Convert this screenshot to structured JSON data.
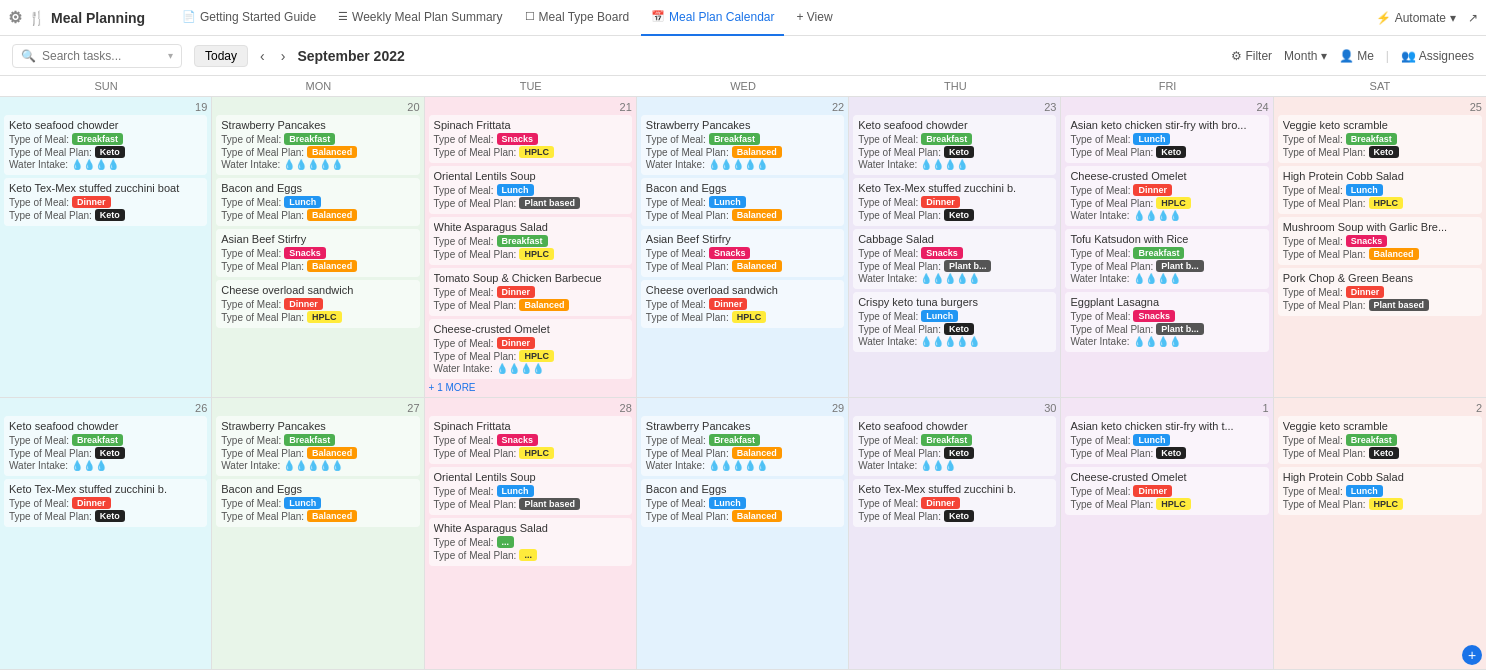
{
  "app": {
    "title": "Meal Planning",
    "logo_icon": "🍴"
  },
  "nav_tabs": [
    {
      "label": "Getting Started Guide",
      "icon": "📄",
      "active": false
    },
    {
      "label": "Weekly Meal Plan Summary",
      "icon": "☰",
      "active": false
    },
    {
      "label": "Meal Type Board",
      "icon": "☐",
      "active": false
    },
    {
      "label": "Meal Plan Calendar",
      "icon": "📅",
      "active": true
    },
    {
      "label": "+ View",
      "icon": "",
      "active": false
    }
  ],
  "nav_right": {
    "automate": "Automate",
    "share_icon": "share"
  },
  "toolbar": {
    "search_placeholder": "Search tasks...",
    "today": "Today",
    "month": "September 2022",
    "filter": "Filter",
    "view": "Month",
    "me": "Me",
    "assignees": "Assignees"
  },
  "calendar": {
    "days": [
      "SUN",
      "MON",
      "TUE",
      "WED",
      "THU",
      "FRI",
      "SAT"
    ],
    "week1": {
      "dates": [
        19,
        20,
        21,
        22,
        23,
        24,
        25
      ],
      "cells": [
        {
          "date": 19,
          "bg": "bg-teal",
          "meals": [
            {
              "title": "Keto seafood chowder",
              "meal_type": "Breakfast",
              "meal_plan": "Keto",
              "water": "💧💧💧💧",
              "meal_badge": "breakfast",
              "plan_badge": "keto"
            },
            {
              "title": "Keto Tex-Mex stuffed zucchini boat",
              "meal_type": "Dinner",
              "meal_plan": "Keto",
              "meal_badge": "dinner",
              "plan_badge": "keto"
            }
          ]
        },
        {
          "date": 20,
          "bg": "bg-green",
          "meals": [
            {
              "title": "Strawberry Pancakes",
              "meal_type": "Breakfast",
              "meal_plan": "Balanced",
              "water": "💧💧💧💧💧",
              "meal_badge": "breakfast",
              "plan_badge": "balanced"
            },
            {
              "title": "Bacon and Eggs",
              "meal_type": "Lunch",
              "meal_plan": "Balanced",
              "meal_badge": "lunch",
              "plan_badge": "balanced"
            },
            {
              "title": "Asian Beef Stirfry",
              "meal_type": "Snacks",
              "meal_plan": "Balanced",
              "meal_badge": "snacks",
              "plan_badge": "balanced"
            },
            {
              "title": "Cheese overload sandwich",
              "meal_type": "Dinner",
              "meal_plan": "HPLC",
              "meal_badge": "dinner",
              "plan_badge": "hplc"
            }
          ]
        },
        {
          "date": 21,
          "bg": "bg-pink",
          "meals": [
            {
              "title": "Spinach Frittata",
              "meal_type": "Snacks",
              "meal_plan": "HPLC",
              "meal_badge": "snacks",
              "plan_badge": "hplc"
            },
            {
              "title": "Oriental Lentils Soup",
              "meal_type": "Lunch",
              "meal_plan": "Plant based",
              "meal_badge": "lunch",
              "plan_badge": "plant-based"
            },
            {
              "title": "White Asparagus Salad",
              "meal_type": "Breakfast",
              "meal_plan": "HPLC",
              "meal_badge": "breakfast",
              "plan_badge": "hplc"
            },
            {
              "title": "Tomato Soup & Chicken Barbecue",
              "meal_type": "Dinner",
              "meal_plan": "Balanced",
              "meal_badge": "dinner",
              "plan_badge": "balanced"
            },
            {
              "title": "Cheese-crusted Omelet",
              "meal_type": "Dinner",
              "meal_plan": "HPLC",
              "water": "💧💧💧💧",
              "meal_badge": "dinner",
              "plan_badge": "hplc"
            }
          ],
          "more": "+ 1 MORE"
        },
        {
          "date": 22,
          "bg": "bg-blue",
          "meals": [
            {
              "title": "Strawberry Pancakes",
              "meal_type": "Breakfast",
              "meal_plan": "Balanced",
              "water": "💧💧💧💧💧",
              "meal_badge": "breakfast",
              "plan_badge": "balanced"
            },
            {
              "title": "Bacon and Eggs",
              "meal_type": "Lunch",
              "meal_plan": "Balanced",
              "meal_badge": "lunch",
              "plan_badge": "balanced"
            },
            {
              "title": "Asian Beef Stirfry",
              "meal_type": "Snacks",
              "meal_plan": "Balanced",
              "meal_badge": "snacks",
              "plan_badge": "balanced"
            },
            {
              "title": "Cheese overload sandwich",
              "meal_type": "Dinner",
              "meal_plan": "HPLC",
              "meal_badge": "dinner",
              "plan_badge": "hplc"
            }
          ]
        },
        {
          "date": 23,
          "bg": "bg-lavender",
          "meals": [
            {
              "title": "Keto seafood chowder",
              "meal_type": "Breakfast",
              "meal_plan": "Keto",
              "water": "💧💧💧💧",
              "meal_badge": "breakfast",
              "plan_badge": "keto"
            },
            {
              "title": "Keto Tex-Mex stuffed zucchini b.",
              "meal_type": "Dinner",
              "meal_plan": "Keto",
              "meal_badge": "dinner",
              "plan_badge": "keto"
            },
            {
              "title": "Cabbage Salad",
              "meal_type": "Snacks",
              "meal_plan": "Plant b...",
              "water": "💧💧💧💧💧",
              "meal_badge": "snacks",
              "plan_badge": "plant-b"
            },
            {
              "title": "Crispy keto tuna burgers",
              "meal_type": "Lunch",
              "meal_plan": "Keto",
              "water": "💧💧💧💧💧",
              "meal_badge": "lunch",
              "plan_badge": "keto"
            }
          ]
        },
        {
          "date": 24,
          "bg": "bg-purple",
          "meals": [
            {
              "title": "Asian keto chicken stir-fry with bro...",
              "meal_type": "Lunch",
              "meal_plan": "Keto",
              "meal_badge": "lunch",
              "plan_badge": "keto"
            },
            {
              "title": "Cheese-crusted Omelet",
              "meal_type": "Dinner",
              "meal_plan": "HPLC",
              "water": "💧💧💧💧",
              "meal_badge": "dinner",
              "plan_badge": "hplc"
            },
            {
              "title": "Tofu Katsudon with Rice",
              "meal_type": "Breakfast",
              "meal_plan": "Plant b...",
              "water": "💧💧💧💧",
              "meal_badge": "breakfast",
              "plan_badge": "plant-b"
            },
            {
              "title": "Eggplant Lasagna",
              "meal_type": "Snacks",
              "meal_plan": "Plant b...",
              "water": "💧💧💧💧",
              "meal_badge": "snacks",
              "plan_badge": "plant-b"
            }
          ]
        },
        {
          "date": 25,
          "bg": "bg-salmon",
          "meals": [
            {
              "title": "Veggie keto scramble",
              "meal_type": "Breakfast",
              "meal_plan": "Keto",
              "meal_badge": "breakfast",
              "plan_badge": "keto"
            },
            {
              "title": "High Protein Cobb Salad",
              "meal_type": "Lunch",
              "meal_plan": "HPLC",
              "meal_badge": "lunch",
              "plan_badge": "hplc"
            },
            {
              "title": "Mushroom Soup with Garlic Bre...",
              "meal_type": "Snacks",
              "meal_plan": "Balanced",
              "meal_badge": "snacks",
              "plan_badge": "balanced"
            },
            {
              "title": "Pork Chop & Green Beans",
              "meal_type": "Dinner",
              "meal_plan": "Plant based",
              "meal_badge": "dinner",
              "plan_badge": "plant-based"
            }
          ]
        }
      ]
    },
    "week2": {
      "dates": [
        26,
        27,
        28,
        29,
        30,
        1,
        2
      ],
      "cells": [
        {
          "date": 26,
          "bg": "bg-teal",
          "meals": [
            {
              "title": "Keto seafood chowder",
              "meal_type": "Breakfast",
              "meal_plan": "Keto",
              "water": "💧💧💧",
              "meal_badge": "breakfast",
              "plan_badge": "keto"
            },
            {
              "title": "Keto Tex-Mex stuffed zucchini b.",
              "meal_type": "Dinner",
              "meal_plan": "Keto",
              "meal_badge": "dinner",
              "plan_badge": "keto"
            }
          ]
        },
        {
          "date": 27,
          "bg": "bg-green",
          "meals": [
            {
              "title": "Strawberry Pancakes",
              "meal_type": "Breakfast",
              "meal_plan": "Balanced",
              "water": "💧💧💧💧💧",
              "meal_badge": "breakfast",
              "plan_badge": "balanced"
            },
            {
              "title": "Bacon and Eggs",
              "meal_type": "Lunch",
              "meal_plan": "Balanced",
              "meal_badge": "lunch",
              "plan_badge": "balanced"
            }
          ]
        },
        {
          "date": 28,
          "bg": "bg-pink",
          "meals": [
            {
              "title": "Spinach Frittata",
              "meal_type": "Snacks",
              "meal_plan": "HPLC",
              "meal_badge": "snacks",
              "plan_badge": "hplc"
            },
            {
              "title": "Oriental Lentils Soup",
              "meal_type": "Lunch",
              "meal_plan": "Plant based",
              "meal_badge": "lunch",
              "plan_badge": "plant-based"
            },
            {
              "title": "White Asparagus Salad",
              "meal_type": "...",
              "meal_plan": "...",
              "meal_badge": "breakfast",
              "plan_badge": "hplc"
            }
          ]
        },
        {
          "date": 29,
          "bg": "bg-blue",
          "meals": [
            {
              "title": "Strawberry Pancakes",
              "meal_type": "Breakfast",
              "meal_plan": "Balanced",
              "water": "💧💧💧💧💧",
              "meal_badge": "breakfast",
              "plan_badge": "balanced"
            },
            {
              "title": "Bacon and Eggs",
              "meal_type": "Lunch",
              "meal_plan": "Balanced",
              "meal_badge": "lunch",
              "plan_badge": "balanced"
            }
          ]
        },
        {
          "date": 30,
          "bg": "bg-lavender",
          "meals": [
            {
              "title": "Keto seafood chowder",
              "meal_type": "Breakfast",
              "meal_plan": "Keto",
              "water": "💧💧💧",
              "meal_badge": "breakfast",
              "plan_badge": "keto"
            },
            {
              "title": "Keto Tex-Mex stuffed zucchini b.",
              "meal_type": "Dinner",
              "meal_plan": "Keto",
              "meal_badge": "dinner",
              "plan_badge": "keto"
            }
          ]
        },
        {
          "date": "1",
          "bg": "bg-purple",
          "meals": [
            {
              "title": "Asian keto chicken stir-fry with t...",
              "meal_type": "Lunch",
              "meal_plan": "Keto",
              "meal_badge": "lunch",
              "plan_badge": "keto"
            },
            {
              "title": "Cheese-crusted Omelet",
              "meal_type": "Dinner",
              "meal_plan": "HPLC",
              "meal_badge": "dinner",
              "plan_badge": "hplc"
            }
          ]
        },
        {
          "date": "2",
          "bg": "bg-salmon",
          "meals": [
            {
              "title": "Veggie keto scramble",
              "meal_type": "Breakfast",
              "meal_plan": "Keto",
              "meal_badge": "breakfast",
              "plan_badge": "keto"
            },
            {
              "title": "High Protein Cobb Salad",
              "meal_type": "Lunch",
              "meal_plan": "HPLC",
              "meal_badge": "lunch",
              "plan_badge": "hplc"
            }
          ],
          "add_task": true
        }
      ]
    }
  }
}
